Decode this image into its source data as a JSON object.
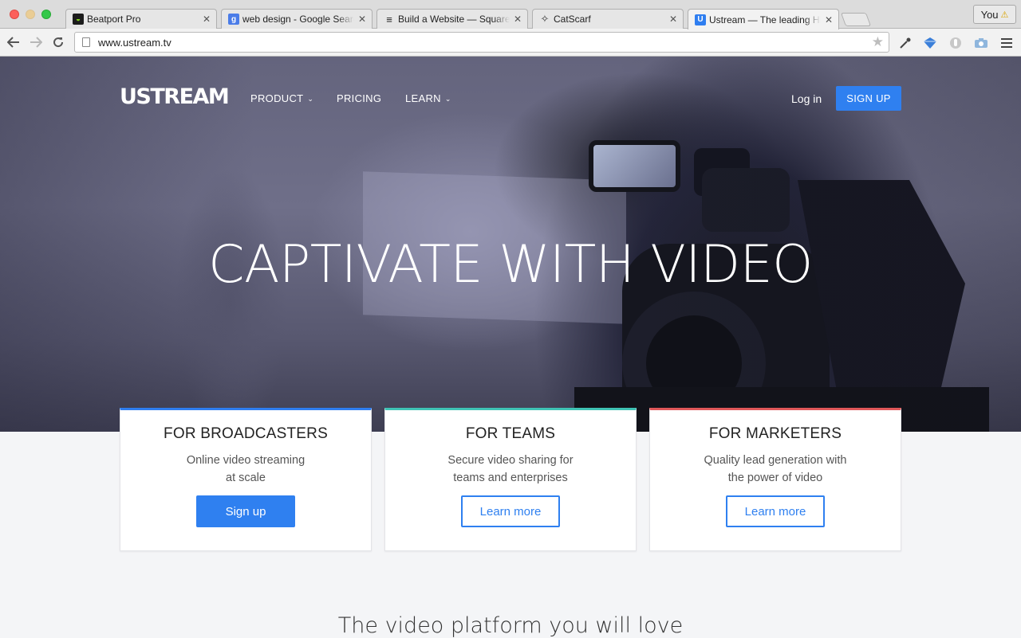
{
  "browser": {
    "tabs": [
      {
        "title": "Beatport Pro",
        "favicon_color": "#1c1c1c",
        "favicon_glyph": "◒"
      },
      {
        "title": "web design - Google Search",
        "favicon_color": "#4a7ce8",
        "favicon_glyph": "g"
      },
      {
        "title": "Build a Website — Squarespace",
        "favicon_color": "#222222",
        "favicon_glyph": "≡"
      },
      {
        "title": "CatScarf",
        "favicon_color": "#333333",
        "favicon_glyph": "✧"
      },
      {
        "title": "Ustream — The leading HD",
        "favicon_color": "#2f7ef0",
        "favicon_glyph": "U"
      }
    ],
    "active_tab": 4,
    "profile_label": "You",
    "profile_icon": "warning-icon",
    "url": "www.ustream.tv"
  },
  "nav": {
    "logo": "USTREAM",
    "items": [
      {
        "label": "PRODUCT",
        "dropdown": true
      },
      {
        "label": "PRICING",
        "dropdown": false
      },
      {
        "label": "LEARN",
        "dropdown": true
      }
    ],
    "login": "Log in",
    "signup": "SIGN UP"
  },
  "hero": {
    "headline": "CAPTIVATE WITH VIDEO"
  },
  "cards": [
    {
      "title": "FOR BROADCASTERS",
      "desc_line1": "Online video streaming",
      "desc_line2": "at scale",
      "button": "Sign up",
      "accent": "#2f7ef0"
    },
    {
      "title": "FOR TEAMS",
      "desc_line1": "Secure video sharing for",
      "desc_line2": "teams and enterprises",
      "button": "Learn more",
      "accent": "#3fc3b5"
    },
    {
      "title": "FOR MARKETERS",
      "desc_line1": "Quality lead generation with",
      "desc_line2": "the power of video",
      "button": "Learn more",
      "accent": "#e0585a"
    }
  ],
  "tagline": "The video platform you will love",
  "colors": {
    "brand_blue": "#2f80f0"
  }
}
